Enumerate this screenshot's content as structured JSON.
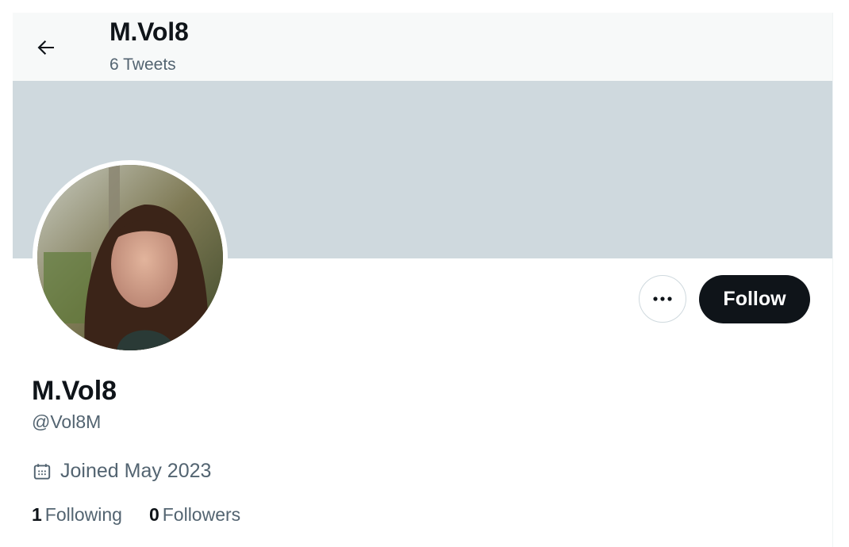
{
  "header": {
    "title": "M.Vol8",
    "tweet_count": "6 Tweets"
  },
  "profile": {
    "display_name": "M.Vol8",
    "handle": "@Vol8M",
    "joined": "Joined May 2023",
    "follow_label": "Follow"
  },
  "stats": {
    "following_count": "1",
    "following_label": "Following",
    "followers_count": "0",
    "followers_label": "Followers"
  },
  "colors": {
    "banner": "#cfd9de",
    "follow_button": "#0f1419",
    "secondary_text": "#536471"
  },
  "icons": [
    "arrow-left-icon",
    "more-horizontal-icon",
    "calendar-icon"
  ]
}
